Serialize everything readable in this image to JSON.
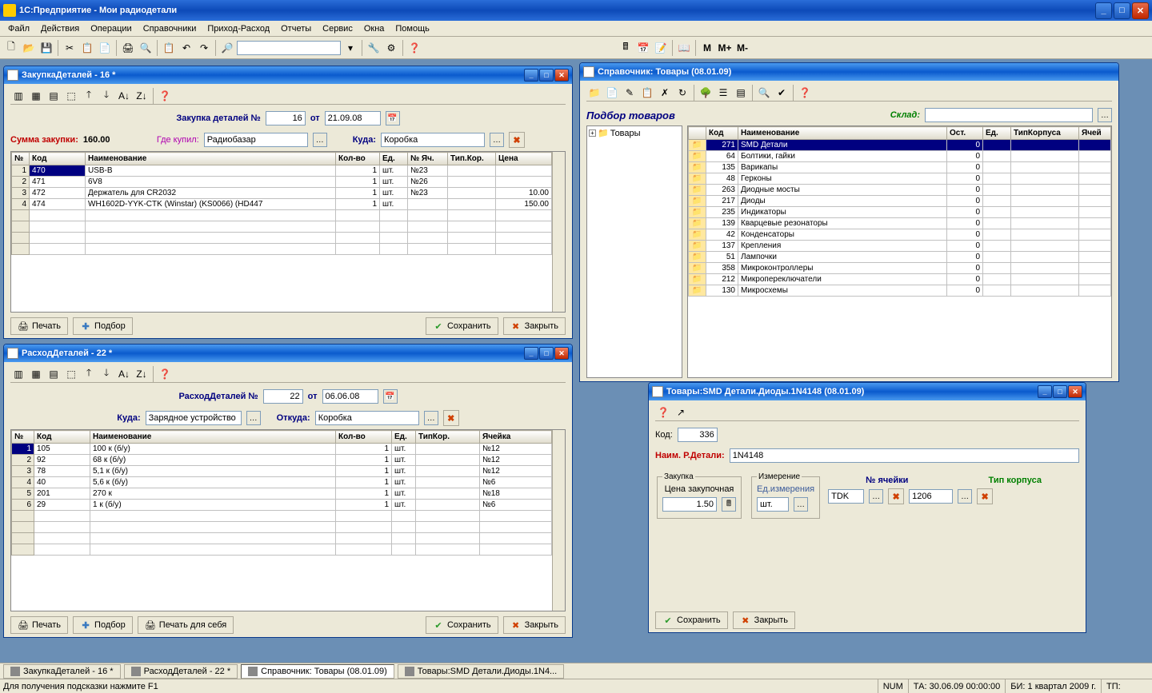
{
  "app": {
    "title": "1С:Предприятие  -  Мои радиодетали"
  },
  "menu": [
    "Файл",
    "Действия",
    "Операции",
    "Справочники",
    "Приход-Расход",
    "Отчеты",
    "Сервис",
    "Окна",
    "Помощь"
  ],
  "toolbar2": {
    "m": "M",
    "mplus": "M+",
    "mminus": "M-"
  },
  "win_purchase": {
    "title": "ЗакупкаДеталей - 16 *",
    "doc_num_label": "Закупка деталей №",
    "doc_num": "16",
    "ot": "от",
    "doc_date": "21.09.08",
    "sum_label": "Сумма закупки:",
    "sum_value": "160.00",
    "where_label": "Где купил:",
    "where_value": "Радиобазар",
    "to_label": "Куда:",
    "to_value": "Коробка",
    "headers": [
      "№",
      "Код",
      "Наименование",
      "Кол-во",
      "Ед.",
      "№ Яч.",
      "Тип.Кор.",
      "Цена"
    ],
    "rows": [
      {
        "n": "1",
        "code": "470",
        "name": "USB-B",
        "qty": "1",
        "unit": "шт.",
        "cell": "№23",
        "case": "",
        "price": ""
      },
      {
        "n": "2",
        "code": "471",
        "name": "6V8",
        "qty": "1",
        "unit": "шт.",
        "cell": "№26",
        "case": "",
        "price": ""
      },
      {
        "n": "3",
        "code": "472",
        "name": "Держатель для CR2032",
        "qty": "1",
        "unit": "шт.",
        "cell": "№23",
        "case": "",
        "price": "10.00"
      },
      {
        "n": "4",
        "code": "474",
        "name": "WH1602D-YYK-CTK (Winstar) (KS0066) (HD447",
        "qty": "1",
        "unit": "шт.",
        "cell": "",
        "case": "",
        "price": "150.00"
      }
    ],
    "print": "Печать",
    "podbor": "Подбор",
    "save": "Сохранить",
    "close": "Закрыть"
  },
  "win_expense": {
    "title": "РасходДеталей - 22 *",
    "doc_num_label": "РасходДеталей №",
    "doc_num": "22",
    "ot": "от",
    "doc_date": "06.06.08",
    "to_label": "Куда:",
    "to_value": "Зарядное устройство",
    "from_label": "Откуда:",
    "from_value": "Коробка",
    "headers": [
      "№",
      "Код",
      "Наименование",
      "Кол-во",
      "Ед.",
      "ТипКор.",
      "Ячейка"
    ],
    "rows": [
      {
        "n": "1",
        "code": "105",
        "name": "100 к (б/у)",
        "qty": "1",
        "unit": "шт.",
        "case": "",
        "cell": "№12"
      },
      {
        "n": "2",
        "code": "92",
        "name": "68 к (б/у)",
        "qty": "1",
        "unit": "шт.",
        "case": "",
        "cell": "№12"
      },
      {
        "n": "3",
        "code": "78",
        "name": "5,1 к (б/у)",
        "qty": "1",
        "unit": "шт.",
        "case": "",
        "cell": "№12"
      },
      {
        "n": "4",
        "code": "40",
        "name": "5,6 к (б/у)",
        "qty": "1",
        "unit": "шт.",
        "case": "",
        "cell": "№6"
      },
      {
        "n": "5",
        "code": "201",
        "name": "270 к",
        "qty": "1",
        "unit": "шт.",
        "case": "",
        "cell": "№18"
      },
      {
        "n": "6",
        "code": "29",
        "name": "1 к (б/у)",
        "qty": "1",
        "unit": "шт.",
        "case": "",
        "cell": "№6"
      }
    ],
    "print": "Печать",
    "podbor": "Подбор",
    "print_self": "Печать для себя",
    "save": "Сохранить",
    "close": "Закрыть"
  },
  "win_catalog": {
    "title": "Справочник: Товары (08.01.09)",
    "title_podbor": "Подбор товаров",
    "sklad_label": "Склад:",
    "tree_root": "Товары",
    "headers": [
      "",
      "Код",
      "Наименование",
      "Ост.",
      "Ед.",
      "ТипКорпуса",
      "Ячей"
    ],
    "rows": [
      {
        "code": "271",
        "name": "SMD Детали",
        "ost": "0",
        "selected": true
      },
      {
        "code": "64",
        "name": "Болтики, гайки",
        "ost": "0"
      },
      {
        "code": "135",
        "name": "Варикапы",
        "ost": "0"
      },
      {
        "code": "48",
        "name": "Герконы",
        "ost": "0"
      },
      {
        "code": "263",
        "name": "Диодные мосты",
        "ost": "0"
      },
      {
        "code": "217",
        "name": "Диоды",
        "ost": "0"
      },
      {
        "code": "235",
        "name": "Индикаторы",
        "ost": "0"
      },
      {
        "code": "139",
        "name": "Кварцевые резонаторы",
        "ost": "0"
      },
      {
        "code": "42",
        "name": "Конденсаторы",
        "ost": "0"
      },
      {
        "code": "137",
        "name": "Крепления",
        "ost": "0"
      },
      {
        "code": "51",
        "name": "Лампочки",
        "ost": "0"
      },
      {
        "code": "358",
        "name": "Микроконтроллеры",
        "ost": "0"
      },
      {
        "code": "212",
        "name": "Микропереключатели",
        "ost": "0"
      },
      {
        "code": "130",
        "name": "Микросхемы",
        "ost": "0"
      }
    ]
  },
  "win_item": {
    "title": "Товары:SMD Детали.Диоды.1N4148 (08.01.09)",
    "code_label": "Код:",
    "code_value": "336",
    "name_label": "Наим. Р.Детали:",
    "name_value": "1N4148",
    "grp_buy": "Закупка",
    "price_label": "Цена закупочная",
    "price_value": "1.50",
    "grp_meas": "Измерение",
    "unit_label": "Ед.измерения",
    "unit_value": "шт.",
    "cell_label": "№ ячейки",
    "cell_value": "TDK",
    "case_label": "Тип корпуса",
    "case_value": "1206",
    "save": "Сохранить",
    "close": "Закрыть"
  },
  "taskbar": {
    "items": [
      {
        "label": "ЗакупкаДеталей - 16 *"
      },
      {
        "label": "РасходДеталей - 22 *"
      },
      {
        "label": "Справочник: Товары (08.01.09)",
        "active": true
      },
      {
        "label": "Товары:SMD Детали.Диоды.1N4..."
      }
    ]
  },
  "status": {
    "hint": "Для получения подсказки нажмите F1",
    "num": "NUM",
    "ta": "ТА: 30.06.09 00:00:00",
    "bi": "БИ: 1 квартал 2009 г.",
    "tp": "ТП:"
  }
}
